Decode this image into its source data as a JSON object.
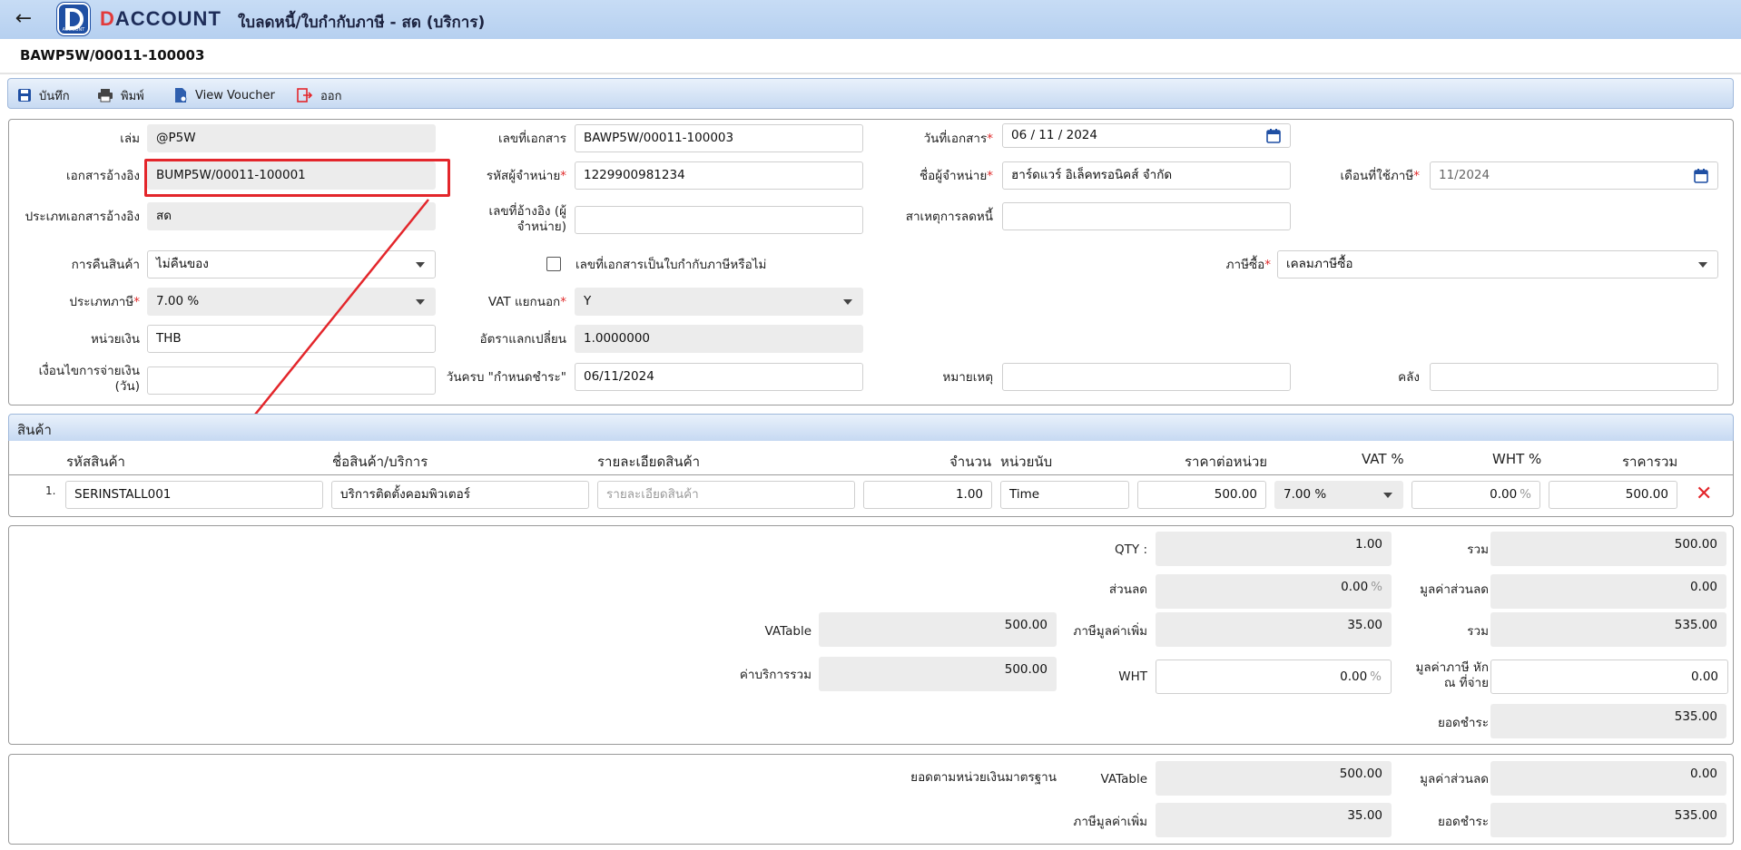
{
  "header": {
    "brand_mark": "D",
    "brand_text": "ACCOUNT",
    "logo_caption": "ACCOUNT",
    "title": "ใบลดหนี้/ใบกำกับภาษี - สด (บริการ)"
  },
  "document_number": "BAWP5W/00011-100003",
  "toolbar": {
    "save": "บันทึก",
    "print": "พิมพ์",
    "view_voucher": "View Voucher",
    "exit": "ออก"
  },
  "form": {
    "book_label": "เล่ม",
    "book_value": "@P5W",
    "ref_doc_label": "เอกสารอ้างอิง",
    "ref_doc_value": "BUMP5W/00011-100001",
    "ref_type_label": "ประเภทเอกสารอ้างอิง",
    "ref_type_value": "สด",
    "return_label": "การคืนสินค้า",
    "return_value": "ไม่คืนของ",
    "tax_type_label": "ประเภทภาษี",
    "tax_type_value": "7.00 %",
    "currency_label": "หน่วยเงิน",
    "currency_value": "THB",
    "payment_terms_label": "เงื่อนไขการจ่ายเงิน (วัน)",
    "payment_terms_value": "",
    "doc_no_label": "เลขที่เอกสาร",
    "doc_no_value": "BAWP5W/00011-100003",
    "vendor_code_label": "รหัสผู้จำหน่าย",
    "vendor_code_value": "1229900981234",
    "vendor_ref_label": "เลขที่อ้างอิง (ผู้จำหน่าย)",
    "vendor_ref_value": "",
    "is_tax_invoice_label": "เลขที่เอกสารเป็นใบกำกับภาษีหรือไม่",
    "vat_separate_label": "VAT แยกนอก",
    "vat_separate_value": "Y",
    "exchange_rate_label": "อัตราแลกเปลี่ยน",
    "exchange_rate_value": "1.0000000",
    "due_date_label": "วันครบ \"กำหนดชำระ\"",
    "due_date_value": "06/11/2024",
    "doc_date_label": "วันที่เอกสาร",
    "doc_date_value": "06 / 11 / 2024",
    "vendor_name_label": "ชื่อผู้จำหน่าย",
    "vendor_name_value": "ฮาร์ดแวร์ อิเล็คทรอนิคส์ จำกัด",
    "reduce_reason_label": "สาเหตุการลดหนี้",
    "reduce_reason_value": "",
    "remark_label": "หมายเหตุ",
    "remark_value": "",
    "tax_month_label": "เดือนที่ใช้ภาษี",
    "tax_month_value": "11/2024",
    "purchase_tax_label": "ภาษีซื้อ",
    "purchase_tax_value": "เคลมภาษีซื้อ",
    "warehouse_label": "คลัง",
    "warehouse_value": ""
  },
  "products": {
    "section_title": "สินค้า",
    "columns": [
      "รหัสสินค้า",
      "ชื่อสินค้า/บริการ",
      "รายละเอียดสินค้า",
      "จำนวน",
      "หน่วยนับ",
      "ราคาต่อหน่วย",
      "VAT %",
      "WHT %",
      "ราคารวม"
    ],
    "rows": [
      {
        "no": "1.",
        "code": "SERINSTALL001",
        "name": "บริการติดตั้งคอมพิวเตอร์",
        "detail_placeholder": "รายละเอียดสินค้า",
        "qty": "1.00",
        "unit": "Time",
        "unit_price": "500.00",
        "vat": "7.00 %",
        "wht": "0.00",
        "total": "500.00"
      }
    ],
    "delete_glyph": "✕"
  },
  "summary": {
    "qty_label": "QTY :",
    "qty_value": "1.00",
    "sum_label": "รวม",
    "sum_value": "500.00",
    "discount_label": "ส่วนลด",
    "discount_value": "0.00",
    "discount_amount_label": "มูลค่าส่วนลด",
    "discount_amount_value": "0.00",
    "vatable_label": "VATable",
    "vatable_value": "500.00",
    "vat_label": "ภาษีมูลค่าเพิ่ม",
    "vat_value": "35.00",
    "total_label": "รวม",
    "total_value": "535.00",
    "service_total_label": "ค่าบริการรวม",
    "service_total_value": "500.00",
    "wht_label": "WHT",
    "wht_value": "0.00",
    "wht_amount_label": "มูลค่าภาษี หัก ณ ที่จ่าย",
    "wht_amount_value": "0.00",
    "net_label": "ยอดชำระ",
    "net_value": "535.00",
    "pct_sign": "%"
  },
  "base_currency": {
    "section_label": "ยอดตามหน่วยเงินมาตรฐาน",
    "vatable_label": "VATable",
    "vatable_value": "500.00",
    "discount_amount_label": "มูลค่าส่วนลด",
    "discount_amount_value": "0.00",
    "vat_label": "ภาษีมูลค่าเพิ่ม",
    "vat_value": "35.00",
    "net_label": "ยอดชำระ",
    "net_value": "535.00"
  },
  "colors": {
    "header_bg": "#b9d2f1",
    "brand_blue": "#1f4fa3",
    "accent_red": "#e3262b",
    "readonly_bg": "#ececec"
  }
}
